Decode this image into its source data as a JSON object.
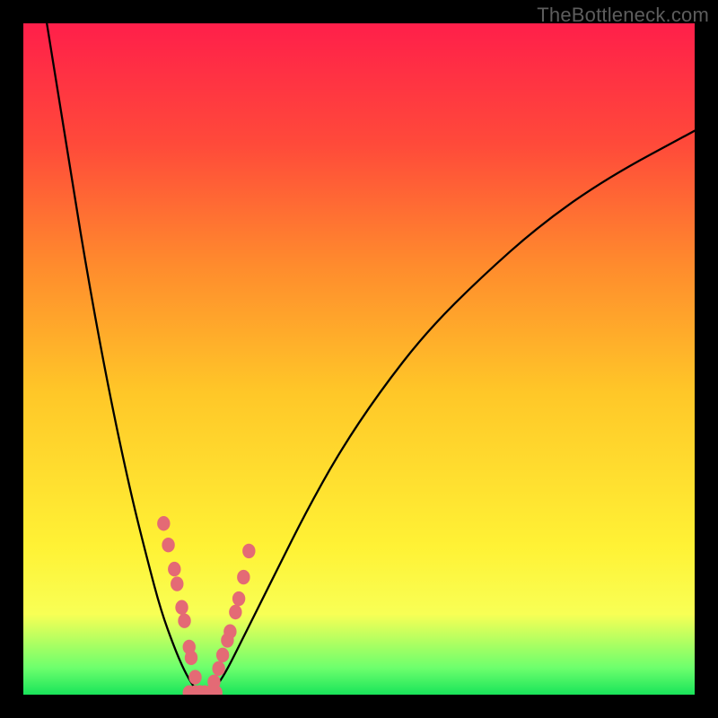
{
  "watermark": "TheBottleneck.com",
  "chart_data": {
    "type": "line",
    "title": "",
    "xlabel": "",
    "ylabel": "",
    "xlim": [
      0,
      100
    ],
    "ylim": [
      0,
      100
    ],
    "grid": false,
    "legend": false,
    "series": [
      {
        "name": "left-curve",
        "x": [
          3.5,
          7,
          10,
          13,
          16,
          18.5,
          20.5,
          22.5,
          24,
          25.3,
          26.3
        ],
        "y": [
          100,
          78,
          60,
          44,
          30,
          20,
          12.5,
          7,
          3.5,
          1.3,
          0
        ]
      },
      {
        "name": "right-curve",
        "x": [
          27.7,
          29,
          30.5,
          32.5,
          35,
          38,
          42,
          47,
          53,
          60,
          68,
          77,
          87,
          100
        ],
        "y": [
          0,
          1.5,
          4,
          8,
          13,
          19,
          27,
          36,
          45,
          54,
          62,
          70,
          77,
          84
        ]
      },
      {
        "name": "dots-left",
        "x": [
          20.9,
          21.6,
          22.5,
          22.9,
          23.6,
          24.0,
          24.7,
          25.0,
          25.6,
          26.3
        ],
        "y": [
          25.5,
          22.3,
          18.7,
          16.5,
          13.0,
          11.0,
          7.1,
          5.5,
          2.6,
          0.3
        ]
      },
      {
        "name": "dots-right",
        "x": [
          27.9,
          28.4,
          29.1,
          29.7,
          30.4,
          30.8,
          31.6,
          32.1,
          32.8,
          33.6
        ],
        "y": [
          0.3,
          1.9,
          3.9,
          5.9,
          8.1,
          9.4,
          12.3,
          14.3,
          17.5,
          21.4
        ]
      },
      {
        "name": "dots-bottom",
        "x": [
          24.7,
          25.6,
          26.3,
          27.0,
          27.9,
          28.7
        ],
        "y": [
          0.3,
          0.3,
          0.3,
          0.3,
          0.3,
          0.3
        ]
      }
    ],
    "gradient_stops": [
      {
        "pos": 0.0,
        "color": "#ff1f4a"
      },
      {
        "pos": 0.18,
        "color": "#ff4a3a"
      },
      {
        "pos": 0.36,
        "color": "#ff8b2d"
      },
      {
        "pos": 0.55,
        "color": "#ffc728"
      },
      {
        "pos": 0.78,
        "color": "#fff235"
      },
      {
        "pos": 0.88,
        "color": "#f8ff55"
      },
      {
        "pos": 0.96,
        "color": "#6dff6d"
      },
      {
        "pos": 1.0,
        "color": "#19e45a"
      }
    ],
    "curve_color": "#000000",
    "dot_color": "#e46a75"
  }
}
